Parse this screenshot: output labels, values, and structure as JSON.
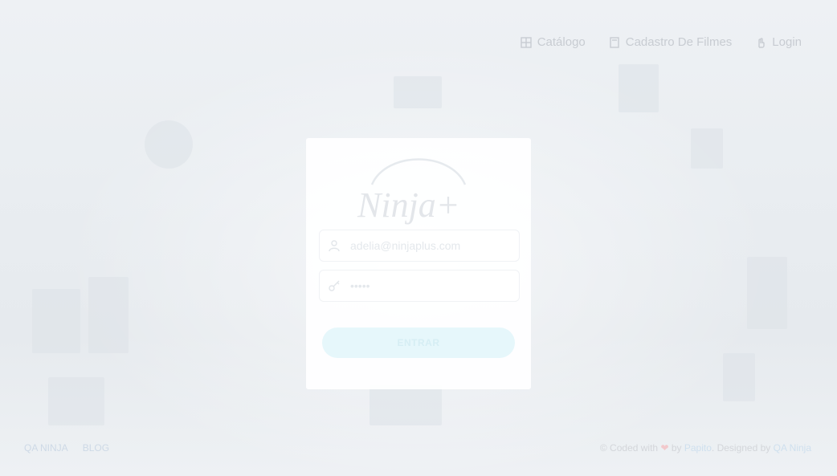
{
  "nav": {
    "items": [
      {
        "label": "Catálogo",
        "icon": "grid-icon"
      },
      {
        "label": "Cadastro De Filmes",
        "icon": "document-icon"
      },
      {
        "label": "Login",
        "icon": "hand-icon"
      }
    ]
  },
  "login": {
    "logo_text": "Ninja+",
    "email": {
      "value": "adelia@ninjaplus.com",
      "icon": "user-icon"
    },
    "password": {
      "value": "•••••",
      "icon": "key-icon"
    },
    "submit_label": "ENTRAR"
  },
  "footer": {
    "links": [
      "QA NINJA",
      "BLOG"
    ],
    "coded_prefix": "© Coded with",
    "heart": "❤",
    "by": "by",
    "author": "Papito",
    "designed_prefix": ". Designed by",
    "designer": "QA Ninja"
  },
  "colors": {
    "accent": "#e6f7fb",
    "nav_text": "#c8ccd2"
  }
}
